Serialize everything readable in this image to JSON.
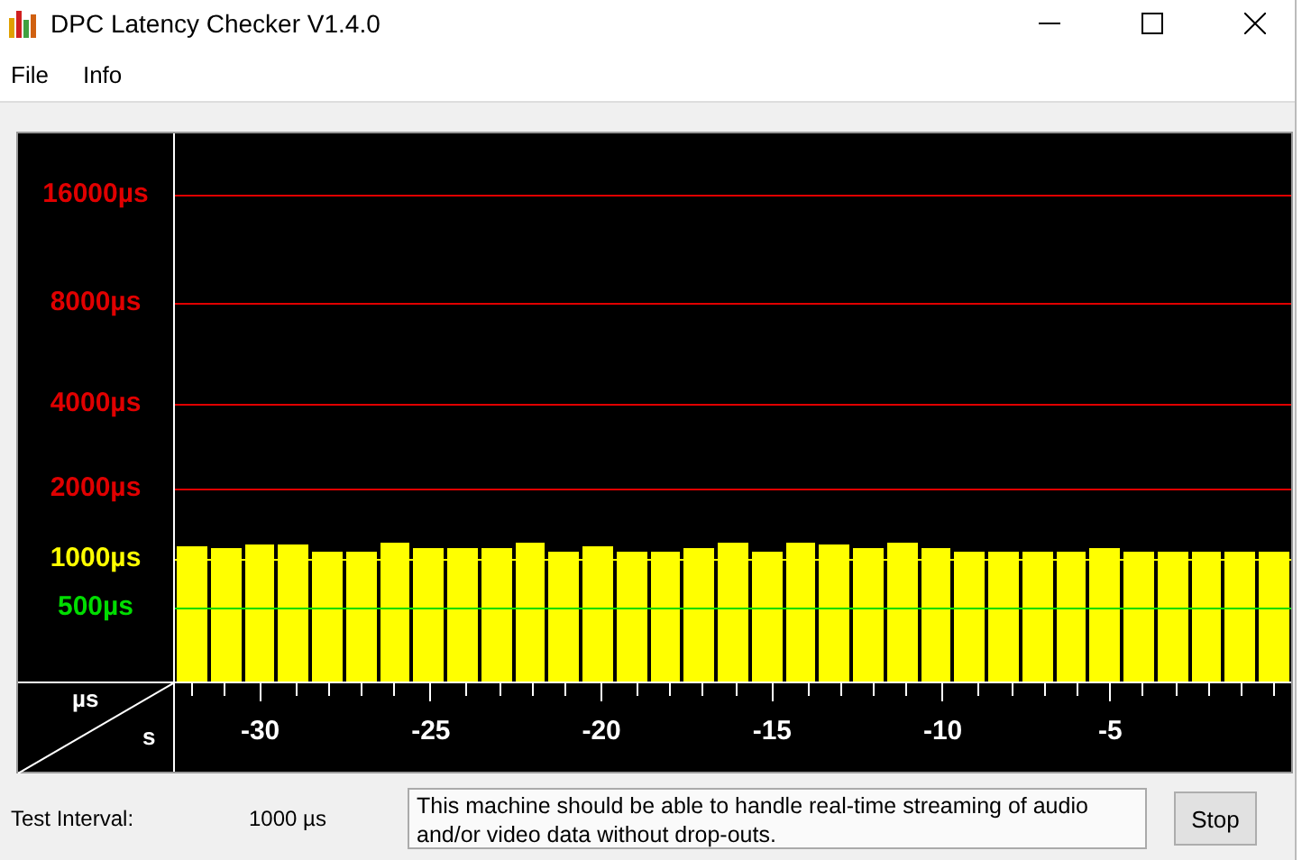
{
  "window": {
    "title": "DPC Latency Checker V1.4.0"
  },
  "menu": [
    "File",
    "Info"
  ],
  "chart": {
    "y_unit": "µs",
    "x_unit": "s",
    "y_labels": [
      {
        "label": "16000µs",
        "color": "#e00000"
      },
      {
        "label": "8000µs",
        "color": "#e00000"
      },
      {
        "label": "4000µs",
        "color": "#e00000"
      },
      {
        "label": "2000µs",
        "color": "#e00000"
      },
      {
        "label": "1000µs",
        "color": "#ffff00"
      },
      {
        "label": "500µs",
        "color": "#00dd00"
      }
    ],
    "x_labels": [
      "-30",
      "-25",
      "-20",
      "-15",
      "-10",
      "-5"
    ],
    "bars": [
      {
        "level": 0.246
      },
      {
        "level": 0.244
      },
      {
        "level": 0.25
      },
      {
        "level": 0.25
      },
      {
        "level": 0.238
      },
      {
        "level": 0.238
      },
      {
        "level": 0.254
      },
      {
        "level": 0.244
      },
      {
        "level": 0.244
      },
      {
        "level": 0.244
      },
      {
        "level": 0.254
      },
      {
        "level": 0.238
      },
      {
        "level": 0.246
      },
      {
        "level": 0.238
      },
      {
        "level": 0.238
      },
      {
        "level": 0.244
      },
      {
        "level": 0.254
      },
      {
        "level": 0.238
      },
      {
        "level": 0.254
      },
      {
        "level": 0.25
      },
      {
        "level": 0.244
      },
      {
        "level": 0.254
      },
      {
        "level": 0.244
      },
      {
        "level": 0.238
      },
      {
        "level": 0.238
      },
      {
        "level": 0.238
      },
      {
        "level": 0.238
      },
      {
        "level": 0.244
      },
      {
        "level": 0.238
      },
      {
        "level": 0.238
      },
      {
        "level": 0.238
      },
      {
        "level": 0.238
      },
      {
        "level": 0.238
      }
    ]
  },
  "status": {
    "interval_label": "Test Interval:",
    "interval_value": "1000 µs",
    "message": "This machine should be able to handle real-time streaming of audio and/or video data without drop-outs.",
    "button": "Stop"
  }
}
